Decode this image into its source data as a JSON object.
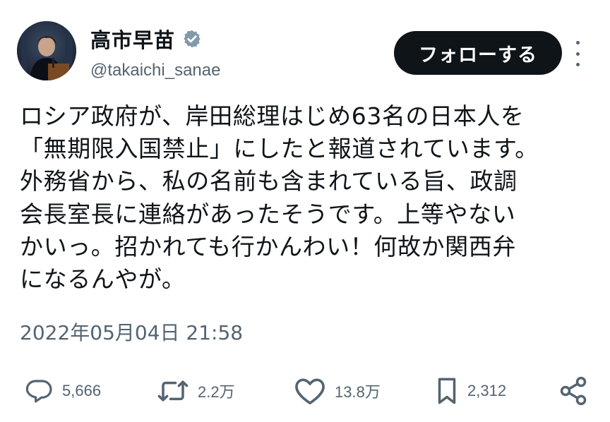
{
  "author": {
    "display_name": "高市早苗",
    "handle": "@takaichi_sanae",
    "verified_icon": "verified-badge"
  },
  "follow_button": {
    "label": "フォローする"
  },
  "more_menu_icon": "more-vertical-icon",
  "tweet": {
    "lines": [
      "ロシア政府が、岸田総理はじめ63名の日本人を",
      "「無期限入国禁止」にしたと報道されています。",
      "外務省から、私の名前も含まれている旨、政調",
      "会長室長に連絡があったそうです。上等やない",
      "かいっ。招かれても行かんわい！何故か関西弁",
      "になるんやが。"
    ],
    "timestamp": "2022年05月04日 21:58"
  },
  "metrics": {
    "replies": "5,666",
    "reposts": "2.2万",
    "likes": "13.8万",
    "bookmarks": "2,312"
  },
  "colors": {
    "text": "#0f1419",
    "secondary": "#536471",
    "verified": "#829aab",
    "button": "#0f1419"
  }
}
